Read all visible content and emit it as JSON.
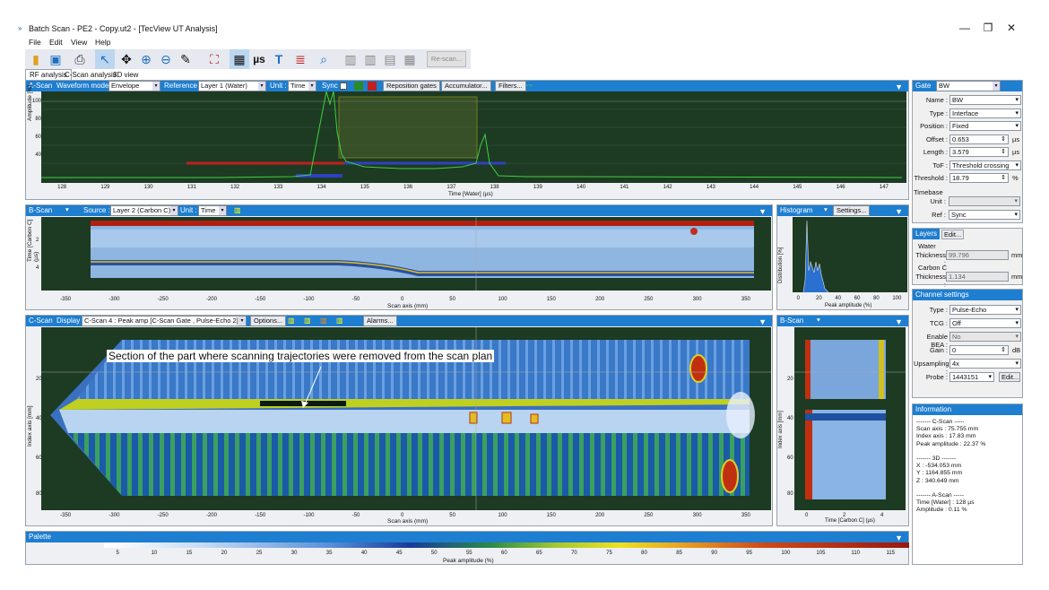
{
  "window": {
    "title": "Batch Scan - PE2 - Copy.ut2 - [TecView UT Analysis]",
    "min": "—",
    "restore": "❐",
    "close": "✕"
  },
  "menu": [
    "File",
    "Edit",
    "View",
    "Help"
  ],
  "toolbar": {
    "rescan": "Re-scan...",
    "mu": "µs",
    "T": "T"
  },
  "tabs": [
    "RF analysis",
    "C-Scan analysis",
    "3D view"
  ],
  "ascan": {
    "title": "A-Scan",
    "waveform_label": "Waveform mode :",
    "waveform": "Envelope",
    "reference_label": "Reference :",
    "reference": "Layer 1 (Water)",
    "unit_label": "Unit :",
    "unit": "Time",
    "sync": "Sync",
    "reposition": "Reposition gates",
    "accumulator": "Accumulator...",
    "filters": "Filters...",
    "ylabel": "Amplitude [%]",
    "xlabel": "Time [Water] (µs)",
    "xticks": [
      "128",
      "129",
      "130",
      "131",
      "132",
      "133",
      "134",
      "135",
      "136",
      "137",
      "138",
      "139",
      "140",
      "141",
      "142",
      "143",
      "144",
      "145",
      "146",
      "147"
    ],
    "yticks": [
      "100",
      "80",
      "60",
      "40",
      "20",
      "0"
    ]
  },
  "bscan": {
    "title": "B-Scan",
    "source_label": "Source :",
    "source": "Layer 2 (Carbon C)",
    "unit_label": "Unit :",
    "unit": "Time",
    "ylabel": "Time [Carbon C] (µs)",
    "xlabel": "Scan axis (mm)",
    "xticks": [
      "-350",
      "-300",
      "-250",
      "-200",
      "-150",
      "-100",
      "-50",
      "0",
      "50",
      "100",
      "150",
      "200",
      "250",
      "300",
      "350"
    ],
    "yticks": [
      "2",
      "4"
    ]
  },
  "histogram": {
    "title": "Histogram",
    "settings": "Settings...",
    "ylabel": "Distribution [%]",
    "xlabel": "Peak amplitude (%)",
    "xticks": [
      "0",
      "20",
      "40",
      "60",
      "80",
      "100"
    ],
    "yticks": [
      "100",
      "80",
      "60",
      "40",
      "20"
    ]
  },
  "cscan": {
    "title": "C-Scan",
    "display_label": "Display :",
    "display": "C-Scan 4 : Peak amp [C-Scan Gate , Pulse-Echo 2]",
    "options": "Options...",
    "alarms": "Alarms...",
    "ylabel": "Index axis [mm]",
    "xlabel": "Scan axis (mm)",
    "annotation": "Section of the part where scanning trajectories were removed from the scan plan",
    "xticks": [
      "-350",
      "-300",
      "-250",
      "-200",
      "-150",
      "-100",
      "-50",
      "0",
      "50",
      "100",
      "150",
      "200",
      "250",
      "300",
      "350"
    ],
    "yticks": [
      "20",
      "40",
      "60",
      "80"
    ]
  },
  "bscan2": {
    "title": "B-Scan",
    "ylabel": "Index axis [mm]",
    "xlabel": "Time [Carbon C] (µs)",
    "xticks": [
      "0",
      "2",
      "4"
    ],
    "yticks": [
      "20",
      "40",
      "60",
      "80"
    ]
  },
  "palette": {
    "title": "Palette",
    "xlabel": "Peak amplitude (%)",
    "ticks": [
      "5",
      "10",
      "15",
      "20",
      "25",
      "30",
      "35",
      "40",
      "45",
      "50",
      "55",
      "60",
      "65",
      "70",
      "75",
      "80",
      "85",
      "90",
      "95",
      "100",
      "105",
      "110",
      "115"
    ]
  },
  "gate": {
    "title": "Gate",
    "name_sel": "BW",
    "fields": [
      {
        "label": "Name :",
        "value": "BW"
      },
      {
        "label": "Type :",
        "value": "Interface"
      },
      {
        "label": "Position :",
        "value": "Fixed"
      },
      {
        "label": "Offset :",
        "value": "0.653",
        "unit": "µs"
      },
      {
        "label": "Length :",
        "value": "3.579",
        "unit": "µs"
      },
      {
        "label": "ToF :",
        "value": "Threshold crossing"
      },
      {
        "label": "Threshold :",
        "value": "18.79",
        "unit": "%"
      }
    ],
    "timebase": "Timebase",
    "unit_label": "Unit :",
    "ref_label": "Ref :",
    "ref": "Sync"
  },
  "layers": {
    "title": "Layers",
    "edit": "Edit...",
    "items": [
      {
        "name": "Water",
        "label": "Thickness :",
        "value": "99.796",
        "unit": "mm"
      },
      {
        "name": "Carbon C",
        "label": "Thickness :",
        "value": "1.134",
        "unit": "mm"
      }
    ]
  },
  "channel": {
    "title": "Channel settings",
    "fields": [
      {
        "label": "Type :",
        "value": "Pulse-Echo"
      },
      {
        "label": "TCG :",
        "value": "Off"
      },
      {
        "label": "Enable BEA :",
        "value": "No"
      },
      {
        "label": "Gain :",
        "value": "0",
        "unit": "dB"
      },
      {
        "label": "Upsampling :",
        "value": "4x"
      },
      {
        "label": "Probe :",
        "value": "1443151",
        "btn": "Edit..."
      }
    ]
  },
  "info": {
    "title": "Information",
    "lines": [
      "------- C-Scan -----",
      "Scan axis : 75.755 mm",
      "Index axis : 17.83 mm",
      "Peak amplitude : 22.37 %",
      "",
      "------- 3D -------",
      "X : -534.053 mm",
      "Y : 1164.855 mm",
      "Z : 340.649 mm",
      "",
      "------- A-Scan -----",
      "Time [Water] : 128 µs",
      "Amplitude : 0.11 %"
    ]
  },
  "colors": {
    "accent": "#1e7ed0",
    "plot_bg": "#1d3b22"
  }
}
